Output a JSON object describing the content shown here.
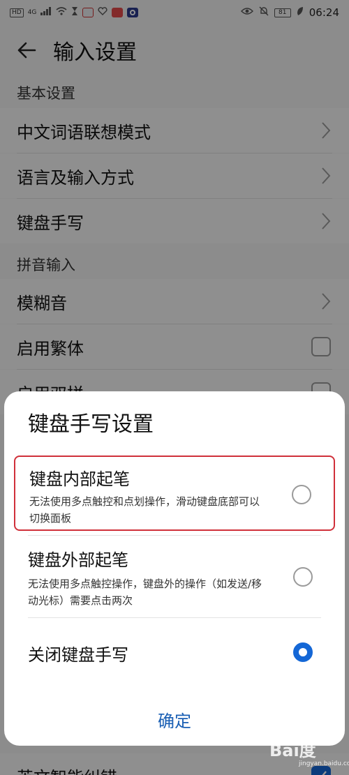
{
  "status_bar": {
    "left_badges": [
      "HD",
      "4G"
    ],
    "battery": "81",
    "time": "06:24"
  },
  "header": {
    "back_icon": "arrow-left-icon",
    "title": "输入设置"
  },
  "sections": [
    {
      "title": "基本设置",
      "items": [
        {
          "label": "中文词语联想模式",
          "trail": "chevron-right-icon"
        },
        {
          "label": "语言及输入方式",
          "trail": "chevron-right-icon"
        },
        {
          "label": "键盘手写",
          "trail": "chevron-right-icon"
        }
      ]
    },
    {
      "title": "拼音输入",
      "items": [
        {
          "label": "模糊音",
          "trail": "chevron-right-icon"
        },
        {
          "label": "启用繁体",
          "trail": "checkbox",
          "checked": false
        },
        {
          "label": "启用双拼",
          "trail": "checkbox",
          "checked": false
        }
      ]
    }
  ],
  "bottom_row": {
    "label": "英文智能纠错",
    "checked": true
  },
  "dialog": {
    "title": "键盘手写设置",
    "options": [
      {
        "title": "键盘内部起笔",
        "desc": "无法使用多点触控和点划操作，滑动键盘底部可以切换面板",
        "selected": false,
        "highlighted": true
      },
      {
        "title": "键盘外部起笔",
        "desc": "无法使用多点触控操作，键盘外的操作（如发送/移动光标）需要点击两次",
        "selected": false,
        "highlighted": false
      },
      {
        "title": "关闭键盘手写",
        "desc": "",
        "selected": true,
        "highlighted": false
      }
    ],
    "confirm_label": "确定"
  },
  "watermark": {
    "logo": "Bai度",
    "sub": "jingyan.baidu.com"
  },
  "colors": {
    "accent": "#1467d6",
    "confirm": "#1a5fb4",
    "highlight": "#d0303a"
  }
}
